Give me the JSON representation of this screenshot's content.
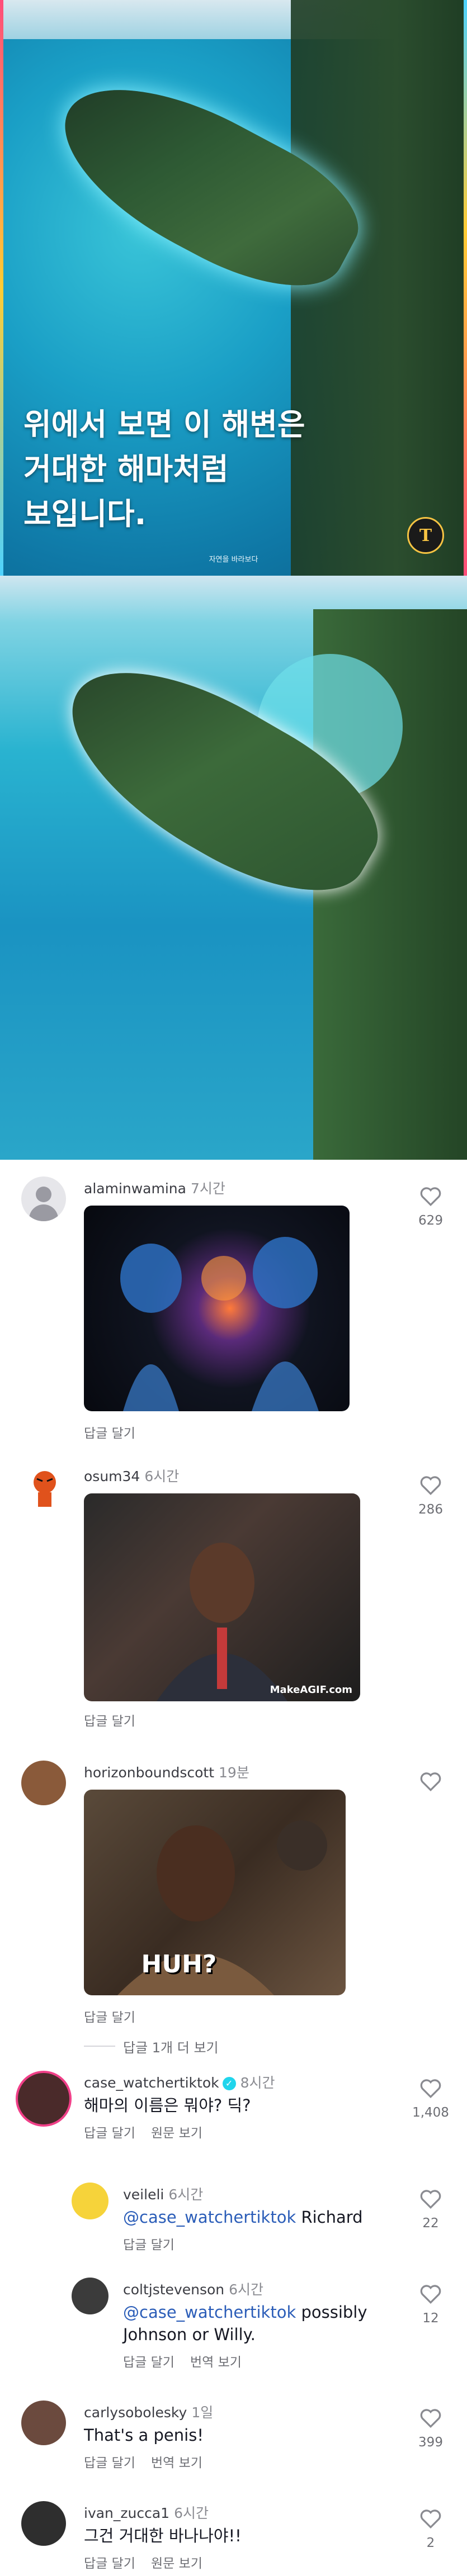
{
  "hero": {
    "caption_lines": [
      "위에서 보면 이 해변은",
      "거대한 해마처럼",
      "보입니다."
    ],
    "subcaption": "자연을 바라보다",
    "logo_letter": "T"
  },
  "comments": [
    {
      "username": "alaminwamina",
      "time": "7시간",
      "reply_label": "답글 달기",
      "likes": "629",
      "gif_caption": ""
    },
    {
      "username": "osum34",
      "time": "6시간",
      "reply_label": "답글 달기",
      "likes": "286",
      "gif_caption": "MakeAGIF.com"
    },
    {
      "username": "horizonboundscott",
      "time": "19분",
      "reply_label": "답글 달기",
      "likes": "",
      "gif_caption": "HUH?"
    }
  ],
  "view_more": "답글 1개 더 보기",
  "thread": {
    "username": "case_watchertiktok",
    "time": "8시간",
    "text": "해마의 이름은 뭐야? 딕?",
    "reply_label": "답글 달기",
    "extra_label": "원문 보기",
    "likes": "1,408"
  },
  "replies": [
    {
      "username": "veileli",
      "time": "6시간",
      "mention": "@case_watchertiktok",
      "text": " Richard",
      "reply_label": "답글 달기",
      "extra_label": "",
      "likes": "22"
    },
    {
      "username": "coltjstevenson",
      "time": "6시간",
      "mention": "@case_watchertiktok",
      "text": " possibly",
      "text2": "Johnson or Willy.",
      "reply_label": "답글 달기",
      "extra_label": "번역 보기",
      "likes": "12"
    }
  ],
  "bottom_comments": [
    {
      "username": "carlysobolesky",
      "time": "1일",
      "text": "That's a penis!",
      "reply_label": "답글 달기",
      "extra_label": "번역 보기",
      "likes": "399"
    },
    {
      "username": "ivan_zucca1",
      "time": "6시간",
      "text": "그건 거대한 바나나야!!",
      "reply_label": "답글 달기",
      "extra_label": "원문 보기",
      "likes": "2"
    }
  ],
  "colors": {
    "accent_blue": "#2b5db8",
    "verified": "#20d5ec",
    "muted": "#6d6e74"
  },
  "icons": [
    "heart-icon",
    "verified-icon",
    "default-avatar-icon"
  ]
}
